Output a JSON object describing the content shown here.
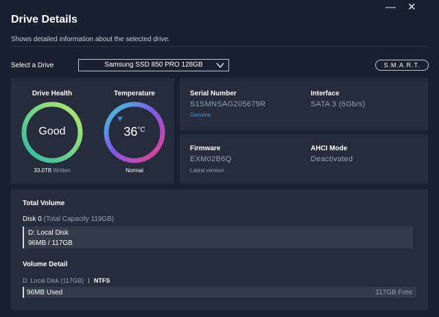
{
  "window": {
    "minimize_glyph": "—",
    "close_glyph": "✕",
    "title": "Drive Details",
    "subtitle": "Shows detailed information about the selected drive."
  },
  "selector": {
    "label": "Select a Drive",
    "selected": "Samsung SSD 850 PRO 128GB",
    "smart_button": "S.M.A.R.T."
  },
  "health": {
    "title": "Drive Health",
    "value": "Good",
    "written_value": "33.0TB",
    "written_label": "Written"
  },
  "temperature": {
    "title": "Temperature",
    "value": "36",
    "unit": "°C",
    "status": "Normal"
  },
  "info": {
    "serial_label": "Serial Number",
    "serial_value": "S1SMNSAG205679R",
    "serial_link": "Genuine",
    "interface_label": "Interface",
    "interface_value": "SATA 3 (6Gb/s)",
    "firmware_label": "Firmware",
    "firmware_value": "EXM02B6Q",
    "firmware_sub": "Latest version",
    "ahci_label": "AHCI Mode",
    "ahci_value": "Deactivated"
  },
  "total_volume": {
    "label": "Total Volume",
    "disk_name": "Disk 0",
    "disk_capacity": "(Total Capacity 119GB)",
    "partition_name": "D: Local Disk",
    "partition_usage": "96MB / 117GB"
  },
  "volume_detail": {
    "label": "Volume Detail",
    "volume_name": "D: Local Disk (117GB)",
    "filesystem": "NTFS",
    "used": "96MB Used",
    "free": "117GB Free"
  },
  "colors": {
    "background": "#1b2030",
    "panel": "#262c3c",
    "link": "#3f9be0",
    "health_ring_start": "#2fb8a8",
    "health_ring_end": "#b7ea6a",
    "temp_ring_start": "#3fd0d8",
    "temp_ring_end": "#e8466a"
  },
  "icons": {
    "select_chevron": "chevron-down-icon",
    "temp_marker": "triangle-marker-icon"
  }
}
